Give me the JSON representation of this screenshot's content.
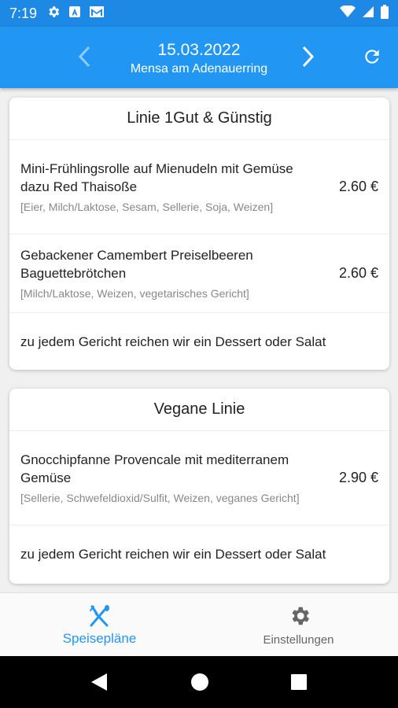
{
  "status": {
    "time": "7:19",
    "icons": [
      "gear-icon",
      "a-notification-icon",
      "mail-icon",
      "wifi-icon",
      "signal-icon",
      "battery-icon"
    ]
  },
  "header": {
    "date": "15.03.2022",
    "mensa": "Mensa am Adenauerring",
    "icons": [
      "chevron-left-icon",
      "chevron-right-icon",
      "refresh-icon"
    ]
  },
  "lines": [
    {
      "title": "Linie 1Gut & Günstig",
      "meals": [
        {
          "name": "Mini-Frühlingsrolle auf Mienudeln mit Gemüse dazu Red Thaisoße",
          "allergens": "[Eier, Milch/Laktose, Sesam, Sellerie, Soja, Weizen]",
          "price": "2.60 €"
        },
        {
          "name": "Gebackener Camembert Preiselbeeren Baguettebrötchen",
          "allergens": "[Milch/Laktose, Weizen, vegetarisches Gericht]",
          "price": "2.60 €"
        },
        {
          "name": "zu jedem Gericht reichen wir ein Dessert oder Salat",
          "allergens": "",
          "price": ""
        }
      ]
    },
    {
      "title": "Vegane Linie",
      "meals": [
        {
          "name": "Gnocchipfanne Provencale mit mediterranem Gemüse",
          "allergens": "[Sellerie, Schwefeldioxid/Sulfit, Weizen, veganes Gericht]",
          "price": "2.90 €"
        },
        {
          "name": "zu jedem Gericht reichen wir ein Dessert oder Salat",
          "allergens": "",
          "price": ""
        }
      ]
    }
  ],
  "bottom_nav": {
    "menus_label": "Speisepläne",
    "settings_label": "Einstellungen",
    "icons": [
      "cutlery-icon",
      "gear-icon"
    ]
  },
  "system_nav": {
    "icons": [
      "back-icon",
      "home-icon",
      "recents-icon"
    ]
  },
  "colors": {
    "status_bar": "#1e88e5",
    "app_bar": "#2196f3",
    "accent": "#2196f3"
  }
}
